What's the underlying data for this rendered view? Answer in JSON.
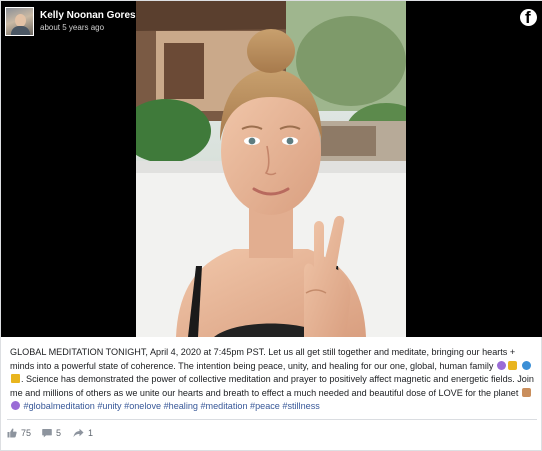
{
  "post": {
    "author": "Kelly Noonan Gores",
    "time": "about 5 years ago",
    "caption_before_emoji_1": "GLOBAL MEDITATION TONIGHT, April 4, 2020 at 7:45pm PST. Let us all get still together and meditate, bringing our hearts + minds into a powerful state of coherence. The intention being peace, unity, and healing for our one, global, human family",
    "caption_after_emoji_1": ". Science has demonstrated the power of collective meditation and prayer to positively affect magnetic and energetic fields. Join me and millions of others as we unite our hearts and breath to effect a much needed and beautiful dose of LOVE for the planet",
    "hashtags": "#globalmeditation #unity #onelove #healing #meditation #peace #stillness",
    "emoji_colors": {
      "purple": "#9b6dd6",
      "globe": "#3b8fd6",
      "yellow": "#e9b51e",
      "skin": "#c98e5c"
    }
  },
  "stats": {
    "likes": "75",
    "comments": "5",
    "shares": "1",
    "icons": [
      "like-icon",
      "comment-icon",
      "share-icon"
    ]
  },
  "brand": {
    "logo_icon": "facebook-icon",
    "link_color": "#385898"
  }
}
